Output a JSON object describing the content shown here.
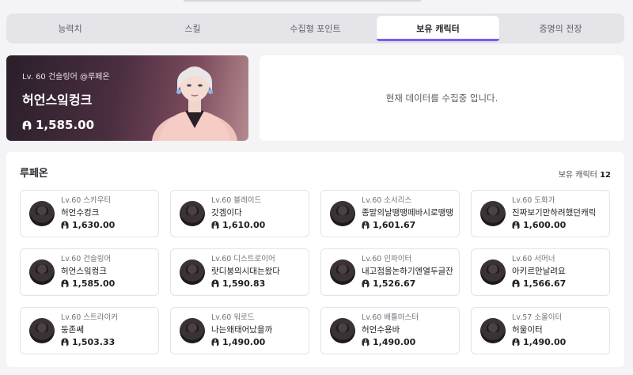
{
  "tabs": [
    {
      "label": "능력치",
      "active": false
    },
    {
      "label": "스킬",
      "active": false
    },
    {
      "label": "수집형 포인트",
      "active": false
    },
    {
      "label": "보유 캐릭터",
      "active": true
    },
    {
      "label": "증명의 전장",
      "active": false
    }
  ],
  "hero": {
    "subtitle": "Lv. 60 건슬링어 @루페온",
    "name": "허언스잌컹크",
    "score": "1,585.00",
    "score_icon": "helmet-icon"
  },
  "status": {
    "message": "현재 데이터를 수집중 입니다."
  },
  "characters": {
    "server": "루페온",
    "count_label": "보유 캐릭터",
    "count": "12",
    "list": [
      {
        "level": "Lv.60 스카우터",
        "name": "허언수컹크",
        "score": "1,630.00"
      },
      {
        "level": "Lv.60 블레이드",
        "name": "갓겜이다",
        "score": "1,610.00"
      },
      {
        "level": "Lv.60 소서리스",
        "name": "종말의날땡땡떼바시로땡땡",
        "score": "1,601.67"
      },
      {
        "level": "Lv.60 도화가",
        "name": "진짜보기만하려했던캐릭",
        "score": "1,600.00"
      },
      {
        "level": "Lv.60 건슬링어",
        "name": "허언스잌컹크",
        "score": "1,585.00"
      },
      {
        "level": "Lv.60 디스트로이어",
        "name": "랏디붕의시대는왔다",
        "score": "1,590.83"
      },
      {
        "level": "Lv.60 인파이터",
        "name": "내고점을논하기엔열두글잔",
        "score": "1,526.67"
      },
      {
        "level": "Lv.60 서머너",
        "name": "아키르만날려요",
        "score": "1,566.67"
      },
      {
        "level": "Lv.60 스트라이커",
        "name": "둥존쎄",
        "score": "1,503.33"
      },
      {
        "level": "Lv.60 워로드",
        "name": "나는왜태어났을까",
        "score": "1,490.00"
      },
      {
        "level": "Lv.60 배틀마스터",
        "name": "허언수용바",
        "score": "1,490.00"
      },
      {
        "level": "Lv.57 소울이터",
        "name": "허울이터",
        "score": "1,490.00"
      }
    ]
  },
  "colors": {
    "accent": "#7d5cf0",
    "panel_bg": "#ffffff",
    "page_bg": "#f4f4f6"
  }
}
